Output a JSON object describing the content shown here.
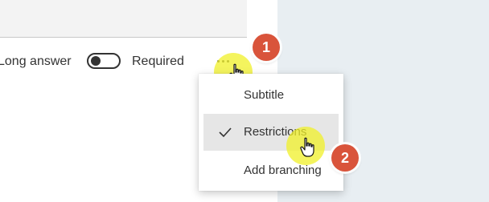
{
  "question": {
    "answer_type_label": "Long answer",
    "required_label": "Required",
    "required_on": false
  },
  "more_menu": {
    "items": [
      {
        "label": "Subtitle",
        "checked": false
      },
      {
        "label": "Restrictions",
        "checked": true
      },
      {
        "label": "Add branching",
        "checked": false
      }
    ]
  },
  "steps": [
    "1",
    "2"
  ],
  "colors": {
    "step_badge": "#d9543b",
    "click_highlight": "#f0f028",
    "side_panel": "#e8eef2"
  }
}
